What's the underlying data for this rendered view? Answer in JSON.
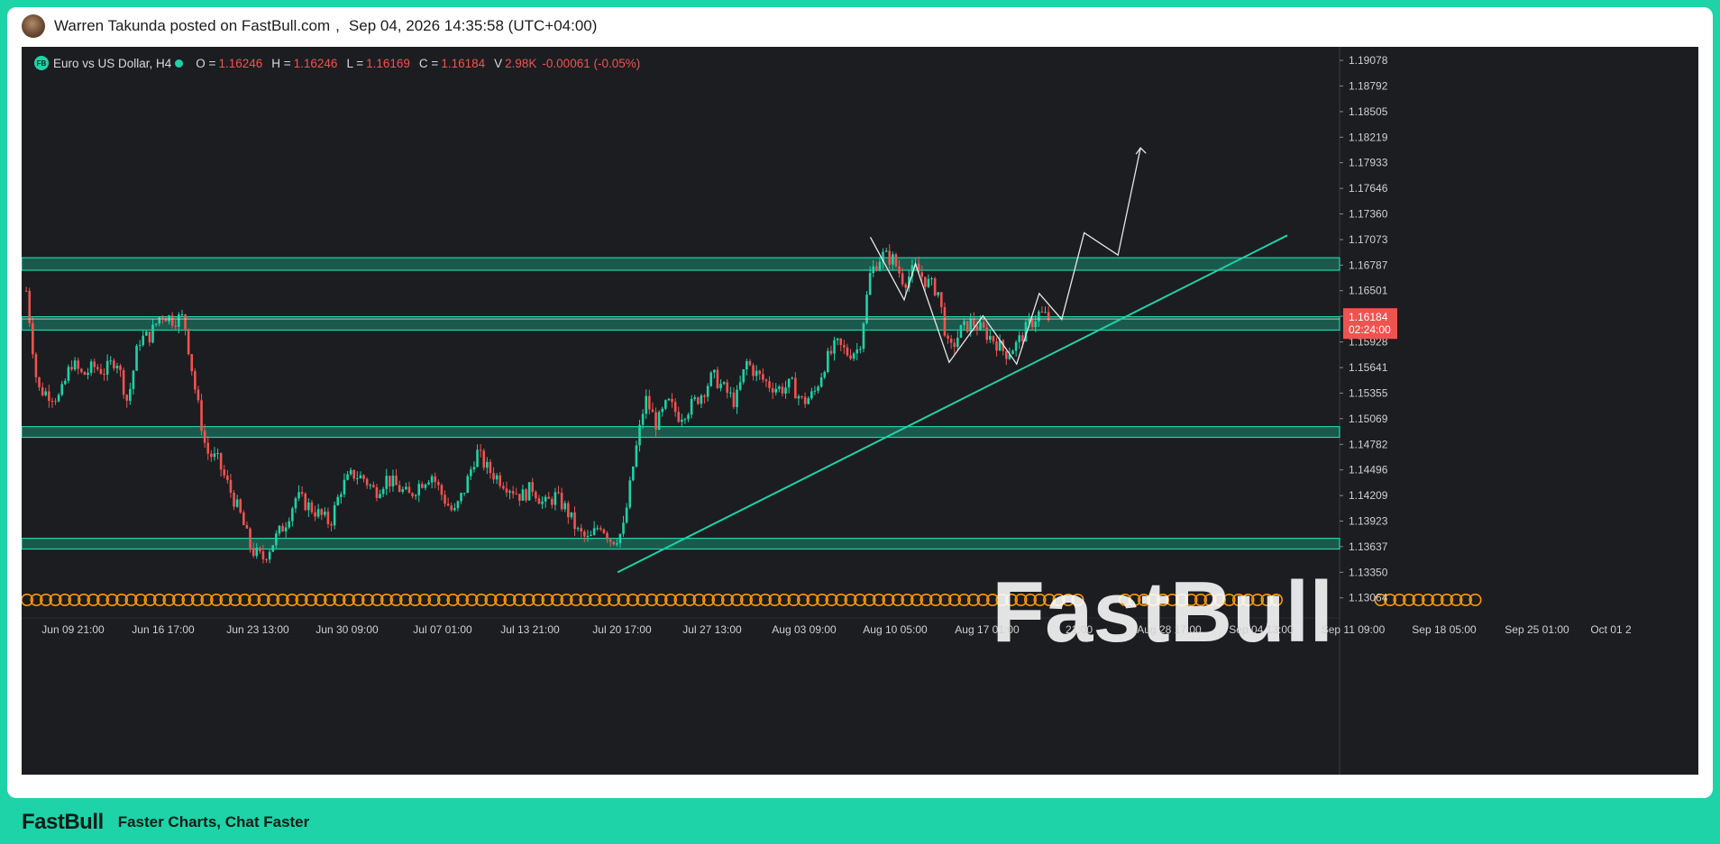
{
  "header": {
    "author_line": "Warren Takunda posted on FastBull.com",
    "separator": ",",
    "timestamp": "Sep 04, 2026 14:35:58 (UTC+04:00)"
  },
  "legend": {
    "badge": "FB",
    "symbol": "Euro vs US Dollar, H4",
    "o_label": "O =",
    "o_value": "1.16246",
    "h_label": "H =",
    "h_value": "1.16246",
    "l_label": "L =",
    "l_value": "1.16169",
    "c_label": "C =",
    "c_value": "1.16184",
    "v_label": "V",
    "v_value": "2.98K",
    "change": "-0.00061 (-0.05%)"
  },
  "footer": {
    "brand": "FastBull",
    "tagline": "Faster Charts, Chat Faster"
  },
  "watermark": "FastBull",
  "colors": {
    "accent": "#1dd3a7",
    "up": "#1dd3a7",
    "down": "#ef5350",
    "background": "#1c1d21",
    "event_marker": "#ff9800"
  },
  "chart_data": {
    "type": "candlestick",
    "title": "Euro vs US Dollar, H4",
    "y_ticks": [
      "1.19078",
      "1.18792",
      "1.18505",
      "1.18219",
      "1.17933",
      "1.17646",
      "1.17360",
      "1.17073",
      "1.16787",
      "1.16501",
      "1.16215",
      "1.15928",
      "1.15641",
      "1.15355",
      "1.15069",
      "1.14782",
      "1.14496",
      "1.14209",
      "1.13923",
      "1.13637",
      "1.13350",
      "1.13064"
    ],
    "ylim": [
      1.1292,
      1.1923
    ],
    "x_ticks": [
      "Jun 09 21:00",
      "Jun 16 17:00",
      "Jun 23 13:00",
      "Jun 30 09:00",
      "Jul 07 01:00",
      "Jul 13 21:00",
      "Jul 20 17:00",
      "Jul 27 13:00",
      "Aug 03 09:00",
      "Aug 10 05:00",
      "Aug 17 01:00",
      "21:00",
      "Aug 28 17:00",
      "Sep 04 13:00",
      "Sep 11 09:00",
      "Sep 18 05:00",
      "Sep 25 01:00",
      "Oct 01 2"
    ],
    "last_price": "1.16184",
    "countdown": "02:24:00",
    "zones": [
      [
        1.1673,
        1.1687
      ],
      [
        1.1606,
        1.1621
      ],
      [
        1.1486,
        1.1498
      ],
      [
        1.1361,
        1.1373
      ]
    ],
    "trendline": {
      "from": [
        "Jul 27 13:00",
        1.1335
      ],
      "to": [
        "Sep 25 01:00",
        1.1712
      ]
    },
    "path_points": [
      [
        "Aug 19",
        1.171
      ],
      [
        "Aug 22",
        1.164
      ],
      [
        "Aug 23",
        1.168
      ],
      [
        "Aug 26",
        1.157
      ],
      [
        "Aug 29",
        1.1622
      ],
      [
        "Sep 01",
        1.1568
      ],
      [
        "Sep 03",
        1.1647
      ],
      [
        "Sep 05",
        1.1618
      ],
      [
        "Sep 07",
        1.1715
      ],
      [
        "Sep 10",
        1.169
      ],
      [
        "Sep 12",
        1.181
      ]
    ],
    "series": [
      {
        "name": "Euro vs US Dollar, H4",
        "close_path": [
          [
            "Jun 05",
            1.165
          ],
          [
            "Jun 06",
            1.154
          ],
          [
            "Jun 08",
            1.153
          ],
          [
            "Jun 09",
            1.157
          ],
          [
            "Jun 10",
            1.1555
          ],
          [
            "Jun 11",
            1.1565
          ],
          [
            "Jun 12",
            1.156
          ],
          [
            "Jun 13",
            1.1575
          ],
          [
            "Jun 14",
            1.1525
          ],
          [
            "Jun 15",
            1.1595
          ],
          [
            "Jun 16",
            1.16
          ],
          [
            "Jun 17",
            1.1625
          ],
          [
            "Jun 18",
            1.1618
          ],
          [
            "Jun 19",
            1.162
          ],
          [
            "Jun 20",
            1.154
          ],
          [
            "Jun 21",
            1.147
          ],
          [
            "Jun 22",
            1.146
          ],
          [
            "Jun 23",
            1.143
          ],
          [
            "Jun 24",
            1.14
          ],
          [
            "Jun 25",
            1.136
          ],
          [
            "Jun 26",
            1.135
          ],
          [
            "Jun 27",
            1.137
          ],
          [
            "Jun 28",
            1.139
          ],
          [
            "Jun 29",
            1.142
          ],
          [
            "Jun 30",
            1.141
          ],
          [
            "Jul 01",
            1.14
          ],
          [
            "Jul 02",
            1.139
          ],
          [
            "Jul 03",
            1.143
          ],
          [
            "Jul 04",
            1.1445
          ],
          [
            "Jul 05",
            1.144
          ],
          [
            "Jul 06",
            1.1425
          ],
          [
            "Jul 07",
            1.144
          ],
          [
            "Jul 08",
            1.143
          ],
          [
            "Jul 09",
            1.142
          ],
          [
            "Jul 10",
            1.1435
          ],
          [
            "Jul 11",
            1.1445
          ],
          [
            "Jul 12",
            1.142
          ],
          [
            "Jul 13",
            1.14
          ],
          [
            "Jul 14",
            1.143
          ],
          [
            "Jul 15",
            1.147
          ],
          [
            "Jul 16",
            1.145
          ],
          [
            "Jul 17",
            1.144
          ],
          [
            "Jul 18",
            1.143
          ],
          [
            "Jul 19",
            1.142
          ],
          [
            "Jul 20",
            1.143
          ],
          [
            "Jul 21",
            1.141
          ],
          [
            "Jul 22",
            1.142
          ],
          [
            "Jul 23",
            1.1405
          ],
          [
            "Jul 24",
            1.138
          ],
          [
            "Jul 25",
            1.137
          ],
          [
            "Jul 26",
            1.139
          ],
          [
            "Jul 27",
            1.137
          ],
          [
            "Jul 28",
            1.138
          ],
          [
            "Jul 29",
            1.146
          ],
          [
            "Jul 30",
            1.153
          ],
          [
            "Jul 31",
            1.15
          ],
          [
            "Aug 01",
            1.1525
          ],
          [
            "Aug 02",
            1.151
          ],
          [
            "Aug 03",
            1.152
          ],
          [
            "Aug 04",
            1.1535
          ],
          [
            "Aug 05",
            1.1555
          ],
          [
            "Aug 06",
            1.154
          ],
          [
            "Aug 07",
            1.1525
          ],
          [
            "Aug 08",
            1.157
          ],
          [
            "Aug 09",
            1.1555
          ],
          [
            "Aug 10",
            1.1545
          ],
          [
            "Aug 11",
            1.154
          ],
          [
            "Aug 12",
            1.1545
          ],
          [
            "Aug 13",
            1.1525
          ],
          [
            "Aug 14",
            1.1535
          ],
          [
            "Aug 15",
            1.157
          ],
          [
            "Aug 16",
            1.159
          ],
          [
            "Aug 17",
            1.158
          ],
          [
            "Aug 18",
            1.1585
          ],
          [
            "Aug 19",
            1.167
          ],
          [
            "Aug 20",
            1.169
          ],
          [
            "Aug 21",
            1.1685
          ],
          [
            "Aug 22",
            1.166
          ],
          [
            "Aug 23",
            1.1675
          ],
          [
            "Aug 24",
            1.166
          ],
          [
            "Aug 25",
            1.165
          ],
          [
            "Aug 26",
            1.158
          ],
          [
            "Aug 27",
            1.1605
          ],
          [
            "Aug 28",
            1.1615
          ],
          [
            "Aug 29",
            1.1605
          ],
          [
            "Aug 30",
            1.1595
          ],
          [
            "Aug 31",
            1.158
          ],
          [
            "Sep 01",
            1.159
          ],
          [
            "Sep 02",
            1.161
          ],
          [
            "Sep 03",
            1.1625
          ],
          [
            "Sep 04",
            1.1618
          ]
        ]
      }
    ]
  }
}
